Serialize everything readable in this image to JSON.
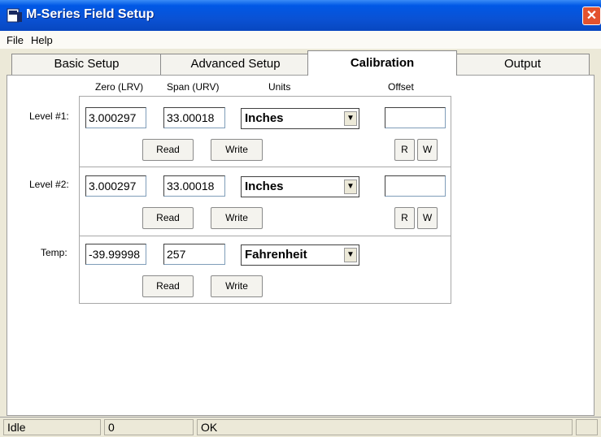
{
  "window": {
    "title": "M-Series Field Setup"
  },
  "menu": {
    "items": [
      "File",
      "Help"
    ]
  },
  "tabs": [
    {
      "label": "Basic Setup",
      "active": false
    },
    {
      "label": "Advanced Setup",
      "active": false
    },
    {
      "label": "Calibration",
      "active": true
    },
    {
      "label": "Output",
      "active": false
    }
  ],
  "calibration": {
    "headers": {
      "zero": "Zero (LRV)",
      "span": "Span (URV)",
      "units": "Units",
      "offset": "Offset"
    },
    "rows": [
      {
        "label": "Level #1:",
        "zero": "3.000297",
        "span": "33.00018",
        "units": "Inches",
        "offset": "",
        "read_label": "Read",
        "write_label": "Write",
        "r_label": "R",
        "w_label": "W"
      },
      {
        "label": "Level #2:",
        "zero": "3.000297",
        "span": "33.00018",
        "units": "Inches",
        "offset": "",
        "read_label": "Read",
        "write_label": "Write",
        "r_label": "R",
        "w_label": "W"
      },
      {
        "label": "Temp:",
        "zero": "-39.99998",
        "span": "257",
        "units": "Fahrenheit",
        "read_label": "Read",
        "write_label": "Write"
      }
    ]
  },
  "status": {
    "state": "Idle",
    "count": "0",
    "message": "OK"
  },
  "icons": {
    "close": "close-icon",
    "app": "app-icon",
    "dropdown": "chevron-down-icon"
  },
  "colors": {
    "titlebar": "#0a52d4",
    "close": "#e3522e",
    "panel": "#ece9d8"
  }
}
